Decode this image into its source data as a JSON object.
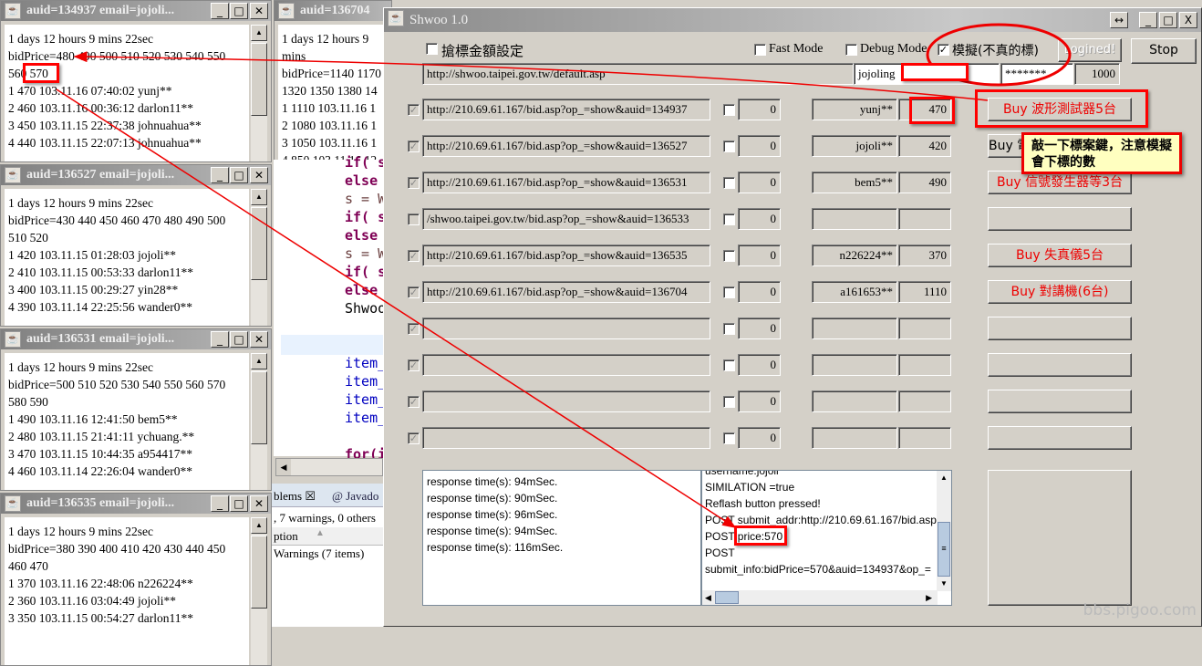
{
  "bid_windows": [
    {
      "title": "auid=134937 email=jojoli...",
      "lines": [
        "1 days 12 hours 9 mins 22sec",
        "bidPrice=480 490 500 510 520 530 540 550",
        "560 570",
        "1 470 103.11.16 07:40:02 yunj**",
        "2 460 103.11.16 00:36:12 darlon11**",
        "3 450 103.11.15 22:37:38 johnuahua**",
        "4 440 103.11.15 22:07:13 johnuahua**"
      ]
    },
    {
      "title": "auid=136527 email=jojoli...",
      "lines": [
        "1 days 12 hours 9 mins 22sec",
        "bidPrice=430 440 450 460 470 480 490 500",
        "510 520",
        "1 420 103.11.15 01:28:03 jojoli**",
        "2 410 103.11.15 00:53:33 darlon11**",
        "3 400 103.11.15 00:29:27 yin28**",
        "4 390 103.11.14 22:25:56 wander0**"
      ]
    },
    {
      "title": "auid=136531 email=jojoli...",
      "lines": [
        "1 days 12 hours 9 mins 22sec",
        "bidPrice=500 510 520 530 540 550 560 570",
        "580 590",
        "1 490 103.11.16 12:41:50 bem5**",
        "2 480 103.11.15 21:41:11 ychuang.**",
        "3 470 103.11.15 10:44:35 a954417**",
        "4 460 103.11.14 22:26:04 wander0**"
      ]
    },
    {
      "title": "auid=136535 email=jojoli...",
      "lines": [
        "1 days 12 hours 9 mins 22sec",
        "bidPrice=380 390 400 410 420 430 440 450",
        "460 470",
        "1 370 103.11.16 22:48:06 n226224**",
        "2 360 103.11.16 03:04:49 jojoli**",
        "3 350 103.11.15 00:54:27 darlon11**"
      ]
    },
    {
      "title": "auid=136704",
      "lines": [
        "1 days 12 hours 9 mins",
        "bidPrice=1140 1170",
        "1320 1350 1380 14",
        "1 1110 103.11.16 1",
        "2 1080 103.11.16 1",
        "3 1050 103.11.16 1",
        "4 850 103.11.16 12"
      ]
    }
  ],
  "editor": {
    "code_lines": [
      {
        "t": "if( s",
        "c": "kw"
      },
      {
        "t": "else",
        "c": "kw"
      },
      {
        "t": "s = W",
        "c": "var"
      },
      {
        "t": "if( s",
        "c": "kw"
      },
      {
        "t": "else",
        "c": "kw"
      },
      {
        "t": "s = W",
        "c": "var"
      },
      {
        "t": "if( s",
        "c": "kw"
      },
      {
        "t": "else",
        "c": "kw"
      },
      {
        "t": "Shwoo",
        "c": ""
      },
      {
        "t": "",
        "c": ""
      },
      {
        "t": "",
        "c": ""
      },
      {
        "t": "item_",
        "c": "fld"
      },
      {
        "t": "item_",
        "c": "fld"
      },
      {
        "t": "item_",
        "c": "fld"
      },
      {
        "t": "item_",
        "c": "fld"
      },
      {
        "t": "",
        "c": ""
      },
      {
        "t": "for(i",
        "c": "kw"
      }
    ],
    "tab_problems": "blems",
    "tab_javadoc": "@ Javado",
    "summary": ", 7 warnings, 0 others",
    "col_description": "ption",
    "warnings": "Warnings (7 items)"
  },
  "shwoo": {
    "title": "Shwoo 1.0",
    "amount_setting": "搶標金額設定",
    "fast_mode": "Fast Mode",
    "debug_mode": "Debug Mode",
    "simulate": "模擬(不真的標)",
    "simulate_checked": true,
    "logined": "Logined!",
    "stop": "Stop",
    "login_url": "http://shwoo.taipei.gov.tw/default.asp",
    "username": "jojoling",
    "password": "*******",
    "interval": "1000",
    "rows": [
      {
        "checked": true,
        "url": "http://210.69.61.167/bid.asp?op_=show&auid=134937",
        "count": "0",
        "bidder": "yunj**",
        "price": "470",
        "buy": "Buy 波形測試器5台"
      },
      {
        "checked": true,
        "url": "http://210.69.61.167/bid.asp?op_=show&auid=136527",
        "count": "0",
        "bidder": "jojoli**",
        "price": "420",
        "buy": "Buy 電"
      },
      {
        "checked": true,
        "url": "http://210.69.61.167/bid.asp?op_=show&auid=136531",
        "count": "0",
        "bidder": "bem5**",
        "price": "490",
        "buy": "Buy 信號發生器等3台"
      },
      {
        "checked": false,
        "url": "/shwoo.taipei.gov.tw/bid.asp?op_=show&auid=136533",
        "count": "0",
        "bidder": "",
        "price": "",
        "buy": ""
      },
      {
        "checked": true,
        "url": "http://210.69.61.167/bid.asp?op_=show&auid=136535",
        "count": "0",
        "bidder": "n226224**",
        "price": "370",
        "buy": "Buy 失真儀5台"
      },
      {
        "checked": true,
        "url": "http://210.69.61.167/bid.asp?op_=show&auid=136704",
        "count": "0",
        "bidder": "a161653**",
        "price": "1110",
        "buy": "Buy 對講機(6台)"
      },
      {
        "checked": true,
        "url": "",
        "count": "0",
        "bidder": "",
        "price": "",
        "buy": ""
      },
      {
        "checked": true,
        "url": "",
        "count": "0",
        "bidder": "",
        "price": "",
        "buy": ""
      },
      {
        "checked": true,
        "url": "",
        "count": "0",
        "bidder": "",
        "price": "",
        "buy": ""
      },
      {
        "checked": true,
        "url": "",
        "count": "0",
        "bidder": "",
        "price": "",
        "buy": ""
      }
    ],
    "response_log": [
      "response time(s): 94mSec.",
      "response time(s): 90mSec.",
      "response time(s): 96mSec.",
      "response time(s): 94mSec.",
      "response time(s): 116mSec."
    ],
    "post_log": [
      "username:jojoli",
      "SIMILATION =true",
      "Reflash button pressed!",
      "POST submit_addr:http://210.69.61.167/bid.asp",
      "POST price:570",
      "POST",
      "submit_info:bidPrice=570&auid=134937&op_="
    ]
  },
  "annotation": {
    "note": "敲一下標案鍵，注意模擬會下標的數",
    "accent": "#ff0000",
    "note_bg": "#ffffc0"
  },
  "watermark": "bbs.pigoo.com"
}
